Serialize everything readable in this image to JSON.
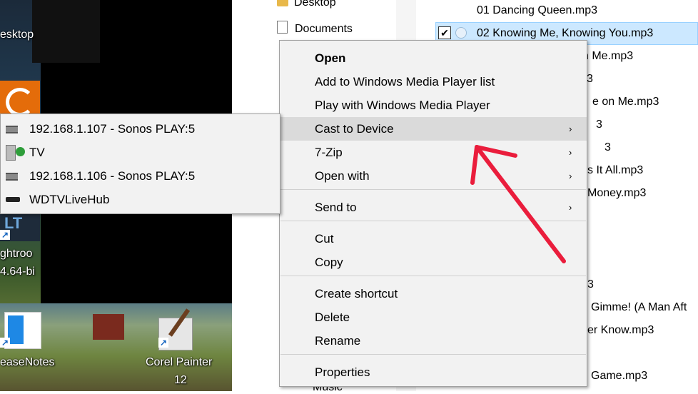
{
  "desktop": {
    "labels": {
      "desktop_partial": "esktop",
      "lightroom_partial": "ghtroo",
      "version_partial": "4.64-bi",
      "release_notes_partial": "easeNotes",
      "corel_painter_line1": "Corel Painter",
      "corel_painter_line2": "12",
      "blue_tile_text": "LT",
      "shortcut_glyph": "↗"
    }
  },
  "explorer": {
    "nav": {
      "desktop": "Desktop",
      "documents": "Documents",
      "music_partial": "Music"
    },
    "files": [
      {
        "text": "01 Dancing Queen.mp3"
      },
      {
        "text": "02 Knowing Me, Knowing You.mp3",
        "selected": true,
        "checked": true
      },
      {
        "text": "n Me.mp3"
      },
      {
        "text": "3"
      },
      {
        "text": "e on Me.mp3"
      },
      {
        "text": "3"
      },
      {
        "text": "3"
      },
      {
        "text": "s It All.mp3"
      },
      {
        "text": "Money.mp3"
      },
      {
        "text": "3"
      },
      {
        "text": "Gimme! (A Man Aft"
      },
      {
        "text": "er Know.mp3"
      },
      {
        "text": "Game.mp3"
      }
    ],
    "checkmark": "✔"
  },
  "context_menu": {
    "open": "Open",
    "add_wmp": "Add to Windows Media Player list",
    "play_wmp": "Play with Windows Media Player",
    "cast": "Cast to Device",
    "seven_zip": "7-Zip",
    "open_with": "Open with",
    "send_to": "Send to",
    "cut": "Cut",
    "copy": "Copy",
    "create_shortcut": "Create shortcut",
    "delete": "Delete",
    "rename": "Rename",
    "properties": "Properties",
    "arrow_glyph": "›"
  },
  "cast_submenu": {
    "devices": [
      {
        "label": "192.168.1.107 - Sonos PLAY:5",
        "icon": "speaker-icon"
      },
      {
        "label": "TV",
        "icon": "tv-icon"
      },
      {
        "label": "192.168.1.106 - Sonos PLAY:5",
        "icon": "speaker-icon"
      },
      {
        "label": "WDTVLiveHub",
        "icon": "media-box-icon"
      }
    ]
  },
  "colors": {
    "menu_bg": "#f2f2f2",
    "menu_highlight": "#dadada",
    "selection_bg": "#cce8ff",
    "annotation_red": "#ea1d3c"
  }
}
